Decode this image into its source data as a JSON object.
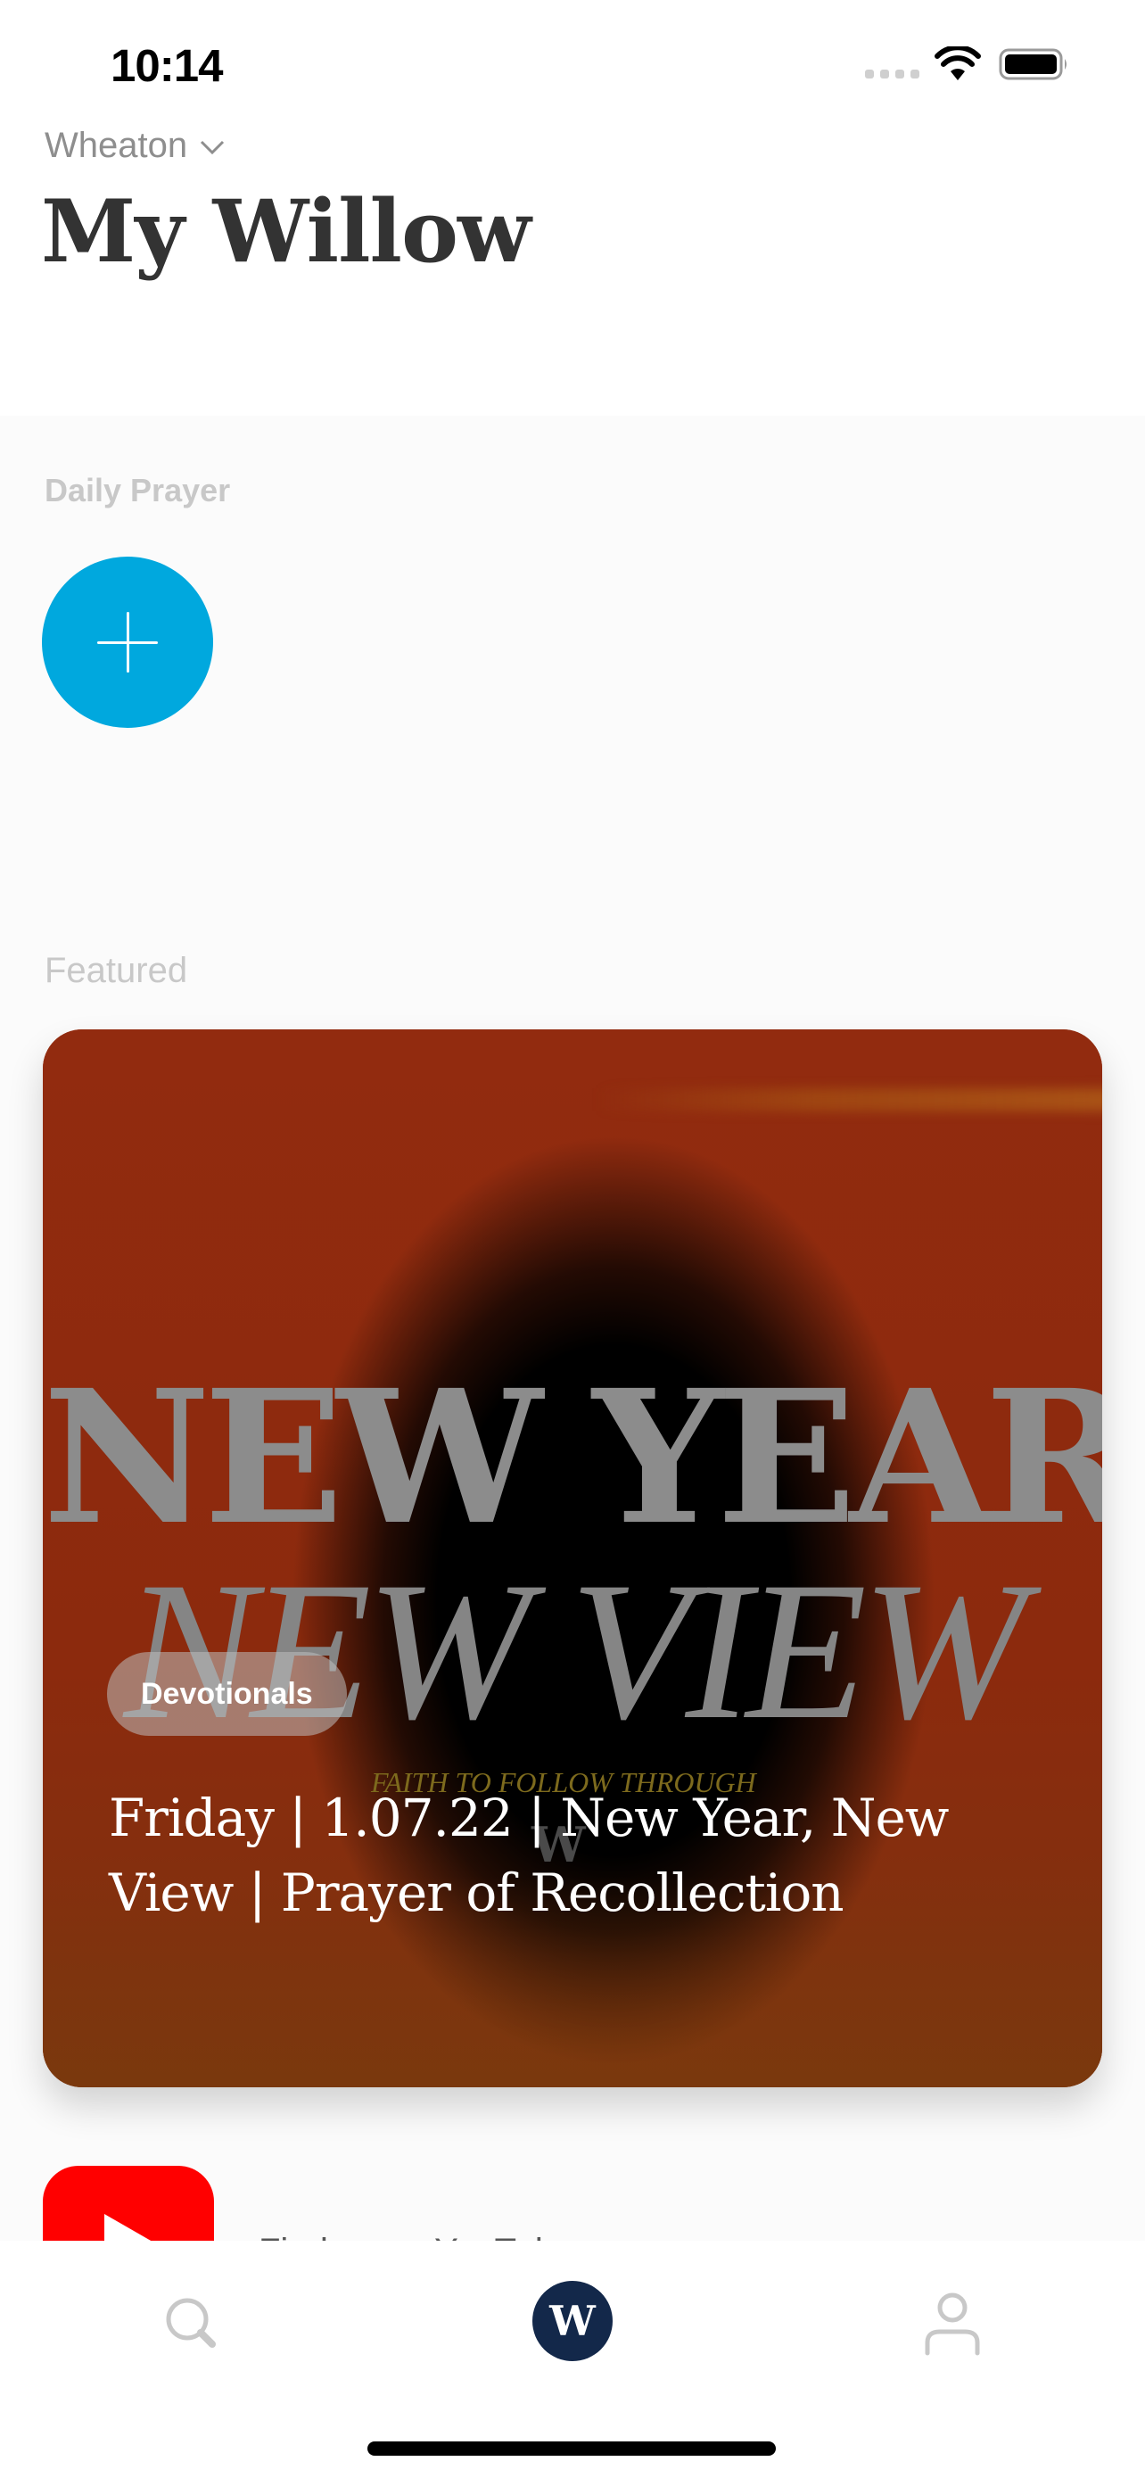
{
  "status_bar": {
    "time": "10:14",
    "signal_icon": "cellular-signal-icon",
    "wifi_icon": "wifi-icon",
    "battery_icon": "battery-icon"
  },
  "header": {
    "location": "Wheaton",
    "location_icon": "chevron-down-icon",
    "title": "My Willow"
  },
  "daily_prayer": {
    "label": "Daily Prayer",
    "add_button_icon": "plus-icon",
    "accent_color": "#00a8de"
  },
  "featured": {
    "label": "Featured",
    "card": {
      "artwork": {
        "line1": "NEW YEAR",
        "line2": "NEW VIEW",
        "tagline": "FAITH TO FOLLOW THROUGH",
        "logo": "W"
      },
      "category": "Devotionals",
      "title": "Friday | 1.07.22 | New Year, New View | Prayer of Recollection"
    }
  },
  "next_item": {
    "icon": "youtube-icon",
    "label": "Find us on YouTube"
  },
  "tab_bar": {
    "tabs": [
      {
        "name": "search",
        "icon": "search-icon",
        "active": false
      },
      {
        "name": "home",
        "icon": "willow-logo-icon",
        "active": true,
        "logo_letter": "W",
        "color": "#13284a"
      },
      {
        "name": "profile",
        "icon": "person-icon",
        "active": false
      }
    ]
  }
}
